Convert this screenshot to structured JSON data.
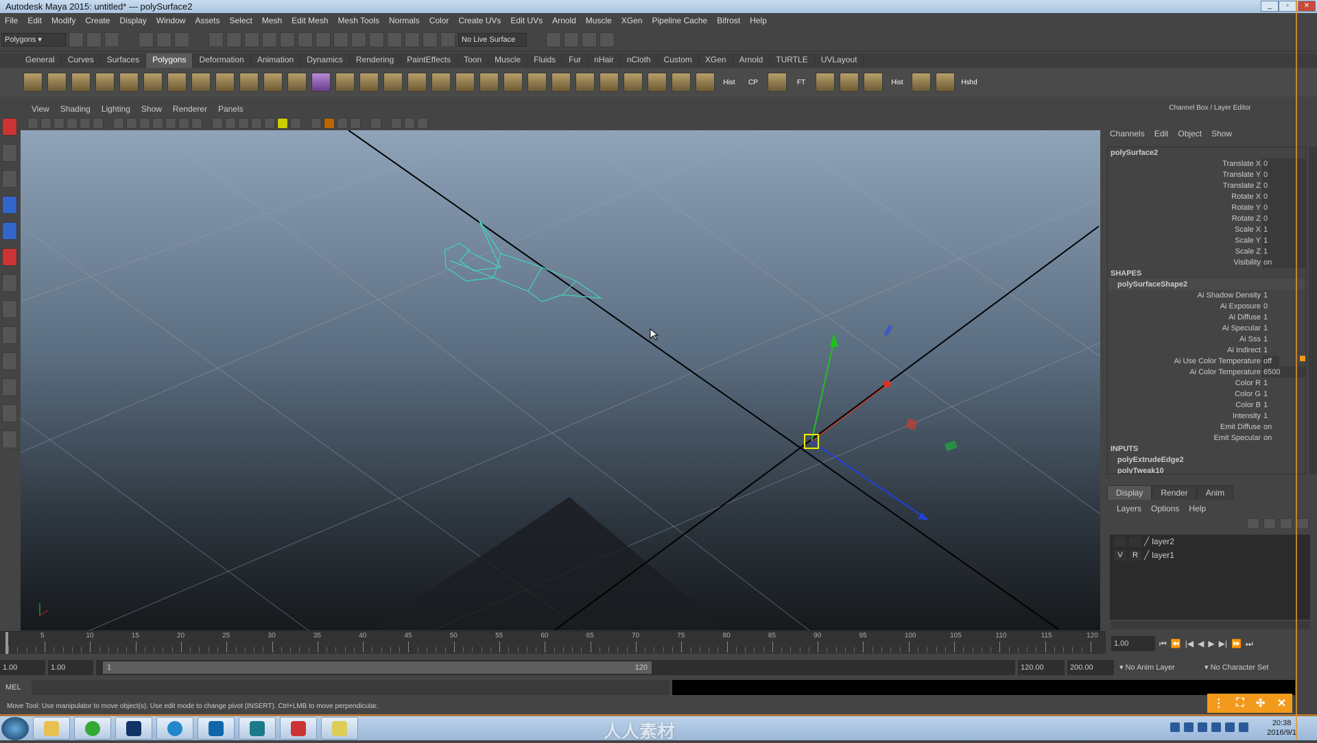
{
  "window": {
    "title": "Autodesk Maya 2015: untitled*   ---   polySurface2"
  },
  "menubar": [
    "File",
    "Edit",
    "Modify",
    "Create",
    "Display",
    "Window",
    "Assets",
    "Select",
    "Mesh",
    "Edit Mesh",
    "Mesh Tools",
    "Normals",
    "Color",
    "Create UVs",
    "Edit UVs",
    "Arnold",
    "Muscle",
    "XGen",
    "Pipeline Cache",
    "Bifrost",
    "Help"
  ],
  "statusline": {
    "mode": "Polygons",
    "live_surface": "No Live Surface"
  },
  "shelf": {
    "tabs": [
      "General",
      "Curves",
      "Surfaces",
      "Polygons",
      "Deformation",
      "Animation",
      "Dynamics",
      "Rendering",
      "PaintEffects",
      "Toon",
      "Muscle",
      "Fluids",
      "Fur",
      "nHair",
      "nCloth",
      "Custom",
      "XGen",
      "Arnold",
      "TURTLE",
      "UVLayout"
    ],
    "active_tab": "Polygons",
    "labels": {
      "hist1": "Hist",
      "cp": "CP",
      "ft": "FT",
      "hist2": "Hist",
      "hshd": "Hshd"
    }
  },
  "viewport": {
    "menu": [
      "View",
      "Shading",
      "Lighting",
      "Show",
      "Renderer",
      "Panels"
    ]
  },
  "channel_box": {
    "title": "Channel Box / Layer Editor",
    "menu": [
      "Channels",
      "Edit",
      "Object",
      "Show"
    ],
    "object": "polySurface2",
    "attributes": [
      {
        "name": "Translate X",
        "value": "0"
      },
      {
        "name": "Translate Y",
        "value": "0"
      },
      {
        "name": "Translate Z",
        "value": "0"
      },
      {
        "name": "Rotate X",
        "value": "0"
      },
      {
        "name": "Rotate Y",
        "value": "0"
      },
      {
        "name": "Rotate Z",
        "value": "0"
      },
      {
        "name": "Scale X",
        "value": "1"
      },
      {
        "name": "Scale Y",
        "value": "1"
      },
      {
        "name": "Scale Z",
        "value": "1"
      },
      {
        "name": "Visibility",
        "value": "on"
      }
    ],
    "shapes_header": "SHAPES",
    "shape": "polySurfaceShape2",
    "shape_attributes": [
      {
        "name": "Ai Shadow Density",
        "value": "1"
      },
      {
        "name": "Ai Exposure",
        "value": "0"
      },
      {
        "name": "Ai Diffuse",
        "value": "1"
      },
      {
        "name": "Ai Specular",
        "value": "1"
      },
      {
        "name": "Ai Sss",
        "value": "1"
      },
      {
        "name": "Ai Indirect",
        "value": "1"
      },
      {
        "name": "Ai Use Color Temperature",
        "value": "off"
      },
      {
        "name": "Ai Color Temperature",
        "value": "6500"
      },
      {
        "name": "Color R",
        "value": "1"
      },
      {
        "name": "Color G",
        "value": "1"
      },
      {
        "name": "Color B",
        "value": "1"
      },
      {
        "name": "Intensity",
        "value": "1"
      },
      {
        "name": "Emit Diffuse",
        "value": "on"
      },
      {
        "name": "Emit Specular",
        "value": "on"
      }
    ],
    "inputs_header": "INPUTS",
    "inputs": [
      "polyExtrudeEdge2",
      "polyTweak10"
    ]
  },
  "layer_editor": {
    "tabs": [
      "Display",
      "Render",
      "Anim"
    ],
    "active_tab": "Display",
    "menu": [
      "Layers",
      "Options",
      "Help"
    ],
    "layers": [
      {
        "name": "layer2",
        "v": "",
        "r": ""
      },
      {
        "name": "layer1",
        "v": "V",
        "r": "R"
      }
    ]
  },
  "timeline": {
    "ticks": [
      "5",
      "10",
      "15",
      "20",
      "25",
      "30",
      "35",
      "40",
      "45",
      "50",
      "55",
      "60",
      "65",
      "70",
      "75",
      "80",
      "85",
      "90",
      "95",
      "100",
      "105",
      "110",
      "115",
      "120"
    ],
    "current_frame_label": "1",
    "current_time": "1.00"
  },
  "range": {
    "start": "1.00",
    "playback_start": "1.00",
    "slider_start": "1",
    "slider_end": "120",
    "playback_end": "120.00",
    "end": "200.00",
    "anim_layer": "No Anim Layer",
    "character_set": "No Character Set"
  },
  "command_line": {
    "label": "MEL"
  },
  "help_line": "Move Tool: Use manipulator to move object(s). Use edit mode to change pivot (INSERT).  Ctrl+LMB to move perpendicular.",
  "taskbar": {
    "time": "20:38",
    "date": "2016/9/1"
  },
  "watermark": "人人素材",
  "colors": {
    "accent_orange": "#f39a1c",
    "wireframe": "#3fd6c0",
    "axis_x": "#e03020",
    "axis_y": "#20c020",
    "axis_z": "#2040e0"
  }
}
